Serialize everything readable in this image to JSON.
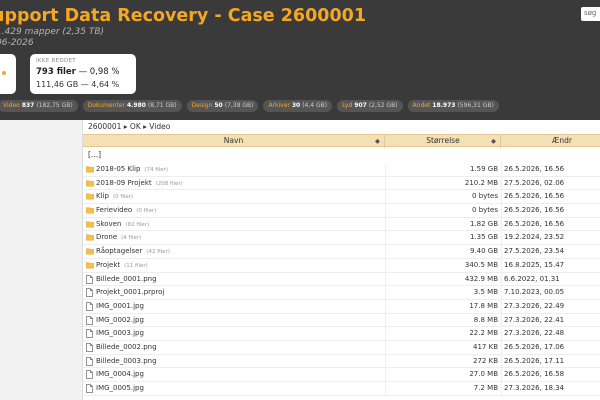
{
  "header": {
    "title": "upport Data Recovery - Case 2600001",
    "subtitle": "1.429 mapper (2,35 TB)",
    "date": "06-2026",
    "search_placeholder": "søg"
  },
  "card": {
    "label": "IKKE REDDET",
    "files_count": "793 filer",
    "files_pct": " — 0,98 %",
    "size": "111,46 GB — 4,64 %"
  },
  "categories": [
    {
      "name": "Video",
      "count": "837",
      "size": "(182,75 GB)"
    },
    {
      "name": "Dokumenter",
      "count": "4.980",
      "size": "(8,71 GB)"
    },
    {
      "name": "Design",
      "count": "50",
      "size": "(7,38 GB)"
    },
    {
      "name": "Arkiver",
      "count": "30",
      "size": "(4,4 GB)"
    },
    {
      "name": "Lyd",
      "count": "907",
      "size": "(2,52 GB)"
    },
    {
      "name": "Andet",
      "count": "18.973",
      "size": "(596,31 GB)"
    }
  ],
  "breadcrumb": "2600001 ▸ OK ▸ Video",
  "table": {
    "columns": {
      "name": "Navn",
      "size": "Størrelse",
      "modified": "Ændr"
    },
    "parent_link": "[...]",
    "rows": [
      {
        "type": "folder",
        "name": "2018-05 Klip",
        "count": "(74 filer)",
        "size": "1.59 GB",
        "date": "26.5.2026, 16.56"
      },
      {
        "type": "folder",
        "name": "2018-09 Projekt",
        "count": "(208 filer)",
        "size": "210.2 MB",
        "date": "27.5.2026, 02.06"
      },
      {
        "type": "folder",
        "name": "Klip",
        "count": "(0 filer)",
        "size": "0 bytes",
        "date": "26.5.2026, 16.56"
      },
      {
        "type": "folder",
        "name": "Ferievideo",
        "count": "(0 filer)",
        "size": "0 bytes",
        "date": "26.5.2026, 16.56"
      },
      {
        "type": "folder",
        "name": "Skoven",
        "count": "(82 filer)",
        "size": "1.82 GB",
        "date": "26.5.2026, 16.56"
      },
      {
        "type": "folder",
        "name": "Drone",
        "count": "(4 filer)",
        "size": "1.35 GB",
        "date": "19.2.2024, 23.52"
      },
      {
        "type": "folder",
        "name": "Råoptagelser",
        "count": "(42 filer)",
        "size": "9.40 GB",
        "date": "27.5.2026, 23.54"
      },
      {
        "type": "folder",
        "name": "Projekt",
        "count": "(11 filer)",
        "size": "340.5 MB",
        "date": "16.8.2025, 15.47"
      },
      {
        "type": "file",
        "name": "Billede_0001.png",
        "count": "",
        "size": "432.9 MB",
        "date": "6.6.2022, 01.31"
      },
      {
        "type": "file",
        "name": "Projekt_0001.prproj",
        "count": "",
        "size": "3.5 MB",
        "date": "7.10.2023, 00.05"
      },
      {
        "type": "file",
        "name": "IMG_0001.jpg",
        "count": "",
        "size": "17.8 MB",
        "date": "27.3.2026, 22.49"
      },
      {
        "type": "file",
        "name": "IMG_0002.jpg",
        "count": "",
        "size": "8.8 MB",
        "date": "27.3.2026, 22.41"
      },
      {
        "type": "file",
        "name": "IMG_0003.jpg",
        "count": "",
        "size": "22.2 MB",
        "date": "27.3.2026, 22.48"
      },
      {
        "type": "file",
        "name": "Billede_0002.png",
        "count": "",
        "size": "417 KB",
        "date": "26.5.2026, 17.06"
      },
      {
        "type": "file",
        "name": "Billede_0003.png",
        "count": "",
        "size": "272 KB",
        "date": "26.5.2026, 17.11"
      },
      {
        "type": "file",
        "name": "IMG_0004.jpg",
        "count": "",
        "size": "27.0 MB",
        "date": "26.5.2026, 16.58"
      },
      {
        "type": "file",
        "name": "IMG_0005.jpg",
        "count": "",
        "size": "7.2 MB",
        "date": "27.3.2026, 18.34"
      }
    ]
  },
  "colors": {
    "accent": "#f5a623",
    "header_bg": "#3a3a3a",
    "table_header_bg": "#f5dfb4"
  }
}
